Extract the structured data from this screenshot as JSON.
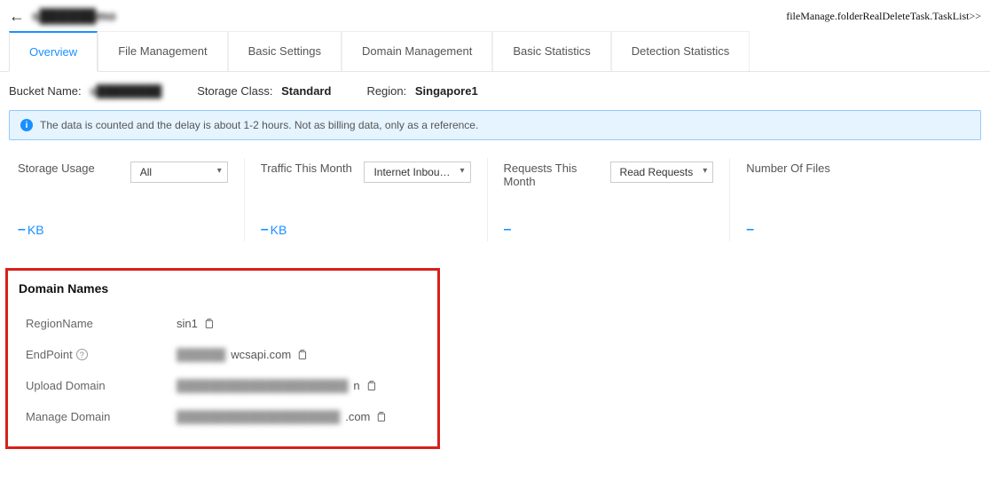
{
  "header": {
    "title": "s██████mo",
    "rightText": "fileManage.folderRealDeleteTask.TaskList>>"
  },
  "tabs": [
    {
      "label": "Overview",
      "active": true
    },
    {
      "label": "File Management",
      "active": false
    },
    {
      "label": "Basic Settings",
      "active": false
    },
    {
      "label": "Domain Management",
      "active": false
    },
    {
      "label": "Basic Statistics",
      "active": false
    },
    {
      "label": "Detection Statistics",
      "active": false
    }
  ],
  "infoRow": {
    "bucketNameLabel": "Bucket Name:",
    "bucketNameValue": "s████████",
    "storageClassLabel": "Storage Class:",
    "storageClassValue": "Standard",
    "regionLabel": "Region:",
    "regionValue": "Singapore1"
  },
  "alert": {
    "text": "The data is counted and the delay is about 1-2 hours. Not as billing data, only as a reference."
  },
  "stats": {
    "storageUsage": {
      "label": "Storage Usage",
      "select": "All",
      "dash": "–",
      "unit": "KB"
    },
    "trafficThisMonth": {
      "label": "Traffic This Month",
      "select": "Internet Inbou…",
      "dash": "–",
      "unit": "KB"
    },
    "requestsThisMonth": {
      "label": "Requests This Month",
      "select": "Read Requests",
      "dash": "–",
      "unit": ""
    },
    "numberOfFiles": {
      "label": "Number Of Files",
      "dash": "–",
      "unit": ""
    }
  },
  "domainNames": {
    "title": "Domain Names",
    "rows": [
      {
        "label": "RegionName",
        "value": "sin1",
        "blurPrefix": "",
        "help": false
      },
      {
        "label": "EndPoint",
        "value": "wcsapi.com",
        "blurPrefix": "██████",
        "help": true
      },
      {
        "label": "Upload Domain",
        "value": "n",
        "blurPrefix": "█████████████████████",
        "help": false
      },
      {
        "label": "Manage Domain",
        "value": ".com",
        "blurPrefix": "████████████████████",
        "help": false
      }
    ]
  }
}
